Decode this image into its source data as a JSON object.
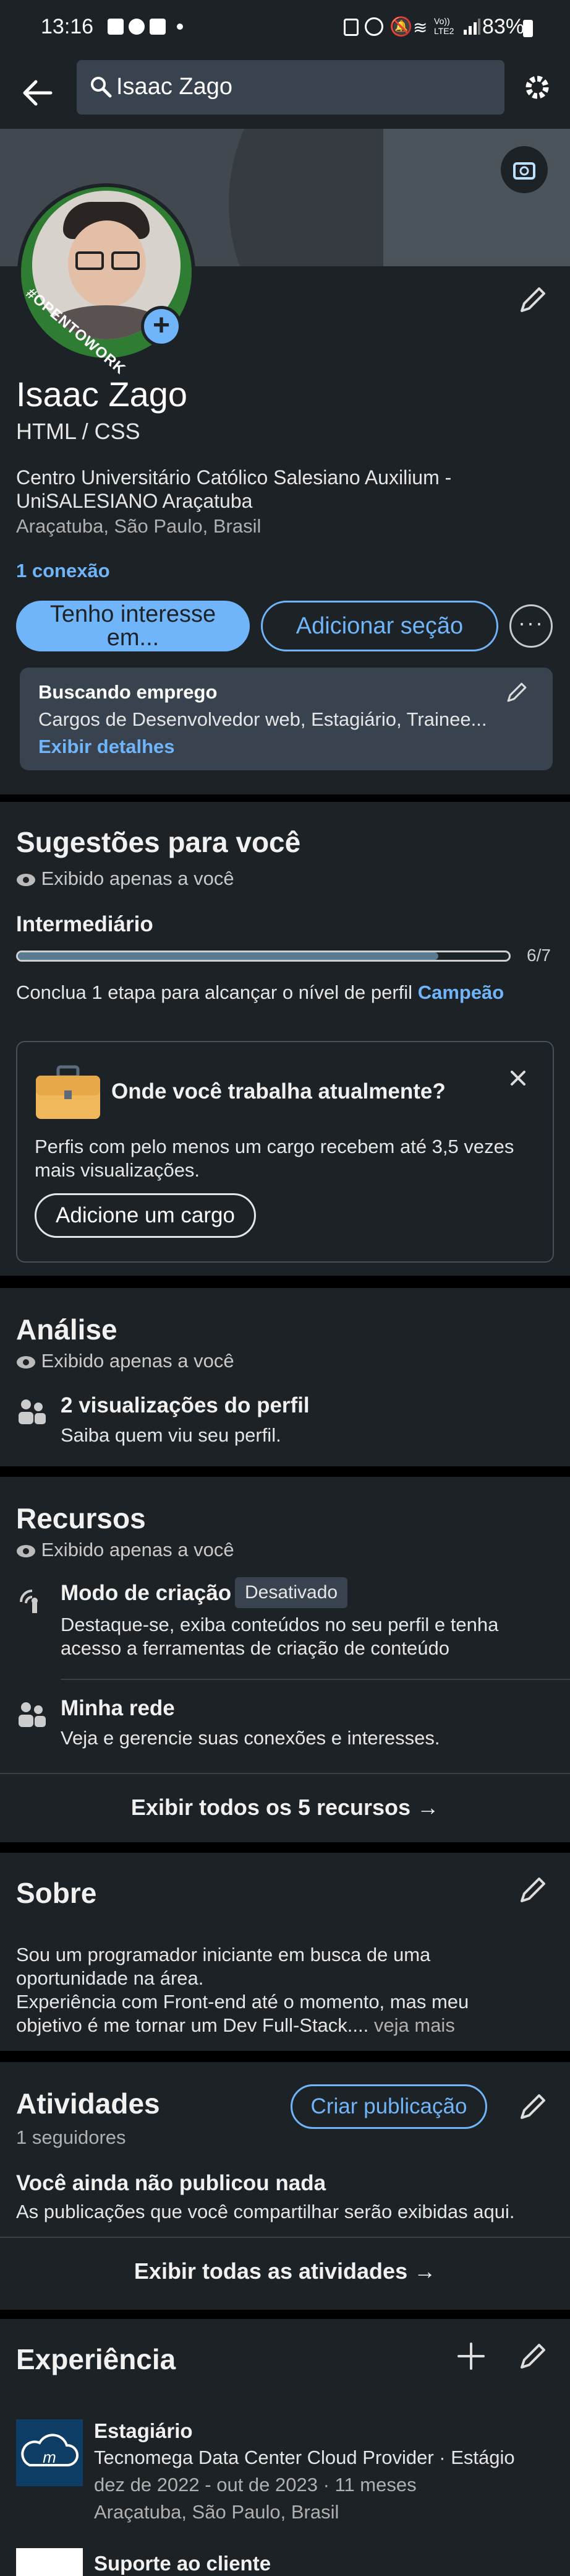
{
  "status_bar": {
    "time": "13:16",
    "battery": "83%",
    "network": "Vo)) LTE2"
  },
  "search": {
    "value": "Isaac Zago"
  },
  "profile": {
    "name": "Isaac Zago",
    "headline": "HTML / CSS",
    "education": "Centro Universitário Católico Salesiano Auxilium - UniSALESIANO Araçatuba",
    "location": "Araçatuba, São Paulo, Brasil",
    "connections": "1 conexão",
    "badge_text": "#OPENTOWORK",
    "open_to_label": "Tenho interesse em...",
    "add_section_label": "Adicionar seção"
  },
  "job_search": {
    "title": "Buscando emprego",
    "roles": "Cargos de Desenvolvedor web, Estagiário, Trainee...",
    "details_link": "Exibir detalhes"
  },
  "suggestions": {
    "title": "Sugestões para você",
    "private_note": "Exibido apenas a você",
    "level": "Intermediário",
    "progress_label": "6/7",
    "progress_fraction": 0.857,
    "hint_prefix": "Conclua 1 etapa para alcançar o nível de perfil ",
    "hint_level": "Campeão",
    "card_title": "Onde você trabalha atualmente?",
    "card_text": "Perfis com pelo menos um cargo recebem até 3,5 vezes mais visualizações.",
    "card_button": "Adicione um cargo"
  },
  "analytics": {
    "title": "Análise",
    "private_note": "Exibido apenas a você",
    "views_title": "2 visualizações do perfil",
    "views_sub": "Saiba quem viu seu perfil."
  },
  "resources": {
    "title": "Recursos",
    "private_note": "Exibido apenas a você",
    "creator_title": "Modo de criação",
    "creator_badge": "Desativado",
    "creator_text": "Destaque-se, exiba conteúdos no seu perfil e tenha acesso a ferramentas de criação de conteúdo",
    "network_title": "Minha rede",
    "network_text": "Veja e gerencie suas conexões e interesses.",
    "show_all": "Exibir todos os 5 recursos →"
  },
  "about": {
    "title": "Sobre",
    "text_1": "Sou um programador iniciante em busca de uma oportunidade na área.",
    "text_2": "Experiência com Front-end até o momento, mas meu objetivo é me tornar um Dev Full-Stack....",
    "see_more": "veja mais"
  },
  "activities": {
    "title": "Atividades",
    "followers": "1 seguidores",
    "create_post": "Criar publicação",
    "empty_title": "Você ainda não publicou nada",
    "empty_text": "As publicações que você compartilhar serão exibidas aqui.",
    "show_all": "Exibir todas as atividades →"
  },
  "experience": {
    "title": "Experiência",
    "items": [
      {
        "role": "Estagiário",
        "company": "Tecnomega Data Center Cloud Provider · Estágio",
        "dates": "dez de 2022 - out de 2023 · 11 meses",
        "location": "Araçatuba, São Paulo, Brasil"
      },
      {
        "role": "Suporte ao cliente"
      }
    ]
  },
  "colors": {
    "accent": "#70b5f9",
    "card": "#1d2226",
    "badge_green": "#2e7d32",
    "cover": "#41484f"
  }
}
